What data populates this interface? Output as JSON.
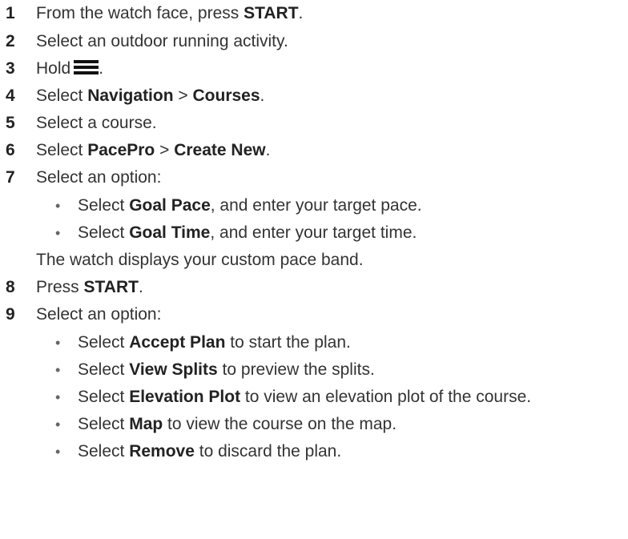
{
  "steps": [
    {
      "num": "1",
      "pre": "From the watch face, press ",
      "b1": "START",
      "post": "."
    },
    {
      "num": "2",
      "text": "Select an outdoor running activity."
    },
    {
      "num": "3",
      "pre": "Hold",
      "icon": "menu-icon",
      "post": "."
    },
    {
      "num": "4",
      "pre": "Select ",
      "b1": "Navigation",
      "mid": " > ",
      "b2": "Courses",
      "post": "."
    },
    {
      "num": "5",
      "text": "Select a course."
    },
    {
      "num": "6",
      "pre": "Select ",
      "b1": "PacePro",
      "mid": " > ",
      "b2": "Create New",
      "post": "."
    },
    {
      "num": "7",
      "text": "Select an option:",
      "options": [
        {
          "pre": "Select ",
          "b": "Goal Pace",
          "post": ", and enter your target pace."
        },
        {
          "pre": "Select ",
          "b": "Goal Time",
          "post": ", and enter your target time."
        }
      ],
      "note": "The watch displays your custom pace band."
    },
    {
      "num": "8",
      "pre": "Press ",
      "b1": "START",
      "post": "."
    },
    {
      "num": "9",
      "text": "Select an option:",
      "options": [
        {
          "pre": "Select ",
          "b": "Accept Plan",
          "post": " to start the plan."
        },
        {
          "pre": "Select ",
          "b": "View Splits",
          "post": " to preview the splits."
        },
        {
          "pre": "Select ",
          "b": "Elevation Plot",
          "post": " to view an elevation plot of the course."
        },
        {
          "pre": "Select ",
          "b": "Map",
          "post": " to view the course on the map."
        },
        {
          "pre": "Select ",
          "b": "Remove",
          "post": " to discard the plan."
        }
      ]
    }
  ],
  "bullet_char": "•"
}
